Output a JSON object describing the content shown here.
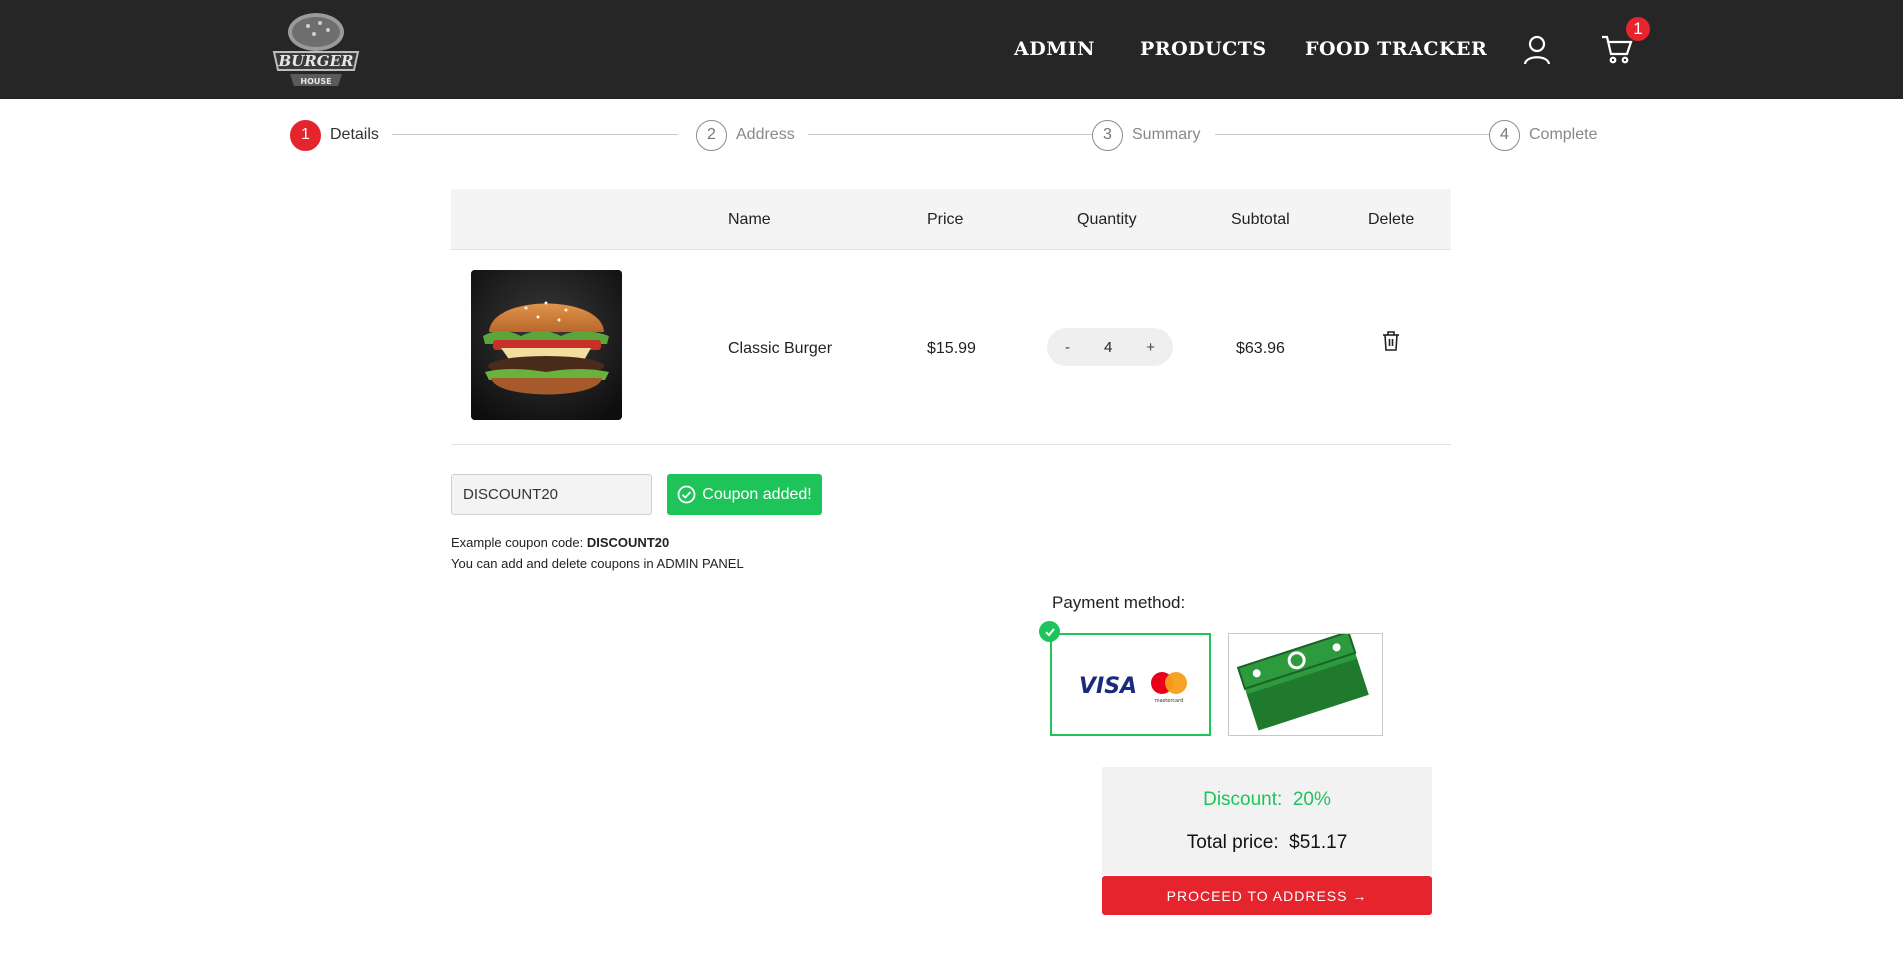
{
  "header": {
    "logo_alt": "Burger House logo",
    "logo_text_top": "BURGER",
    "logo_text_bottom": "HOUSE",
    "nav": [
      "ADMIN",
      "PRODUCTS",
      "FOOD TRACKER"
    ],
    "cart_count": "1",
    "icons": [
      "user-icon",
      "cart-icon"
    ]
  },
  "stepper": {
    "steps": [
      {
        "number": "1",
        "label": "Details",
        "active": true
      },
      {
        "number": "2",
        "label": "Address",
        "active": false
      },
      {
        "number": "3",
        "label": "Summary",
        "active": false
      },
      {
        "number": "4",
        "label": "Complete",
        "active": false
      }
    ]
  },
  "cart": {
    "columns": [
      "",
      "Name",
      "Price",
      "Quantity",
      "Subtotal",
      "Delete"
    ],
    "items": [
      {
        "image": "burger-photo",
        "name": "Classic Burger",
        "price": "$15.99",
        "quantity": "4",
        "subtotal": "$63.96",
        "decrease": "-",
        "increase": "+"
      }
    ]
  },
  "coupon": {
    "value": "DISCOUNT20",
    "button_label": "Coupon added!",
    "hint_prefix": "Example coupon code: ",
    "hint_code": "DISCOUNT20",
    "hint_line2": "You can add and delete coupons in ADMIN PANEL"
  },
  "payment": {
    "title": "Payment method:",
    "selected": "card",
    "card_brand": "VISA",
    "card_brand2": "mastercard",
    "colors": {
      "selected": "#1ec45a",
      "cash": "#1f7a2e"
    }
  },
  "summary": {
    "discount_label": "Discount:",
    "discount_value": "20%",
    "total_label": "Total price:",
    "total_value": "$51.17"
  },
  "actions": {
    "proceed_label": "PROCEED TO ADDRESS →"
  },
  "colors": {
    "accent": "#e5242e",
    "success": "#1ec45a",
    "header_bg": "#262626"
  }
}
